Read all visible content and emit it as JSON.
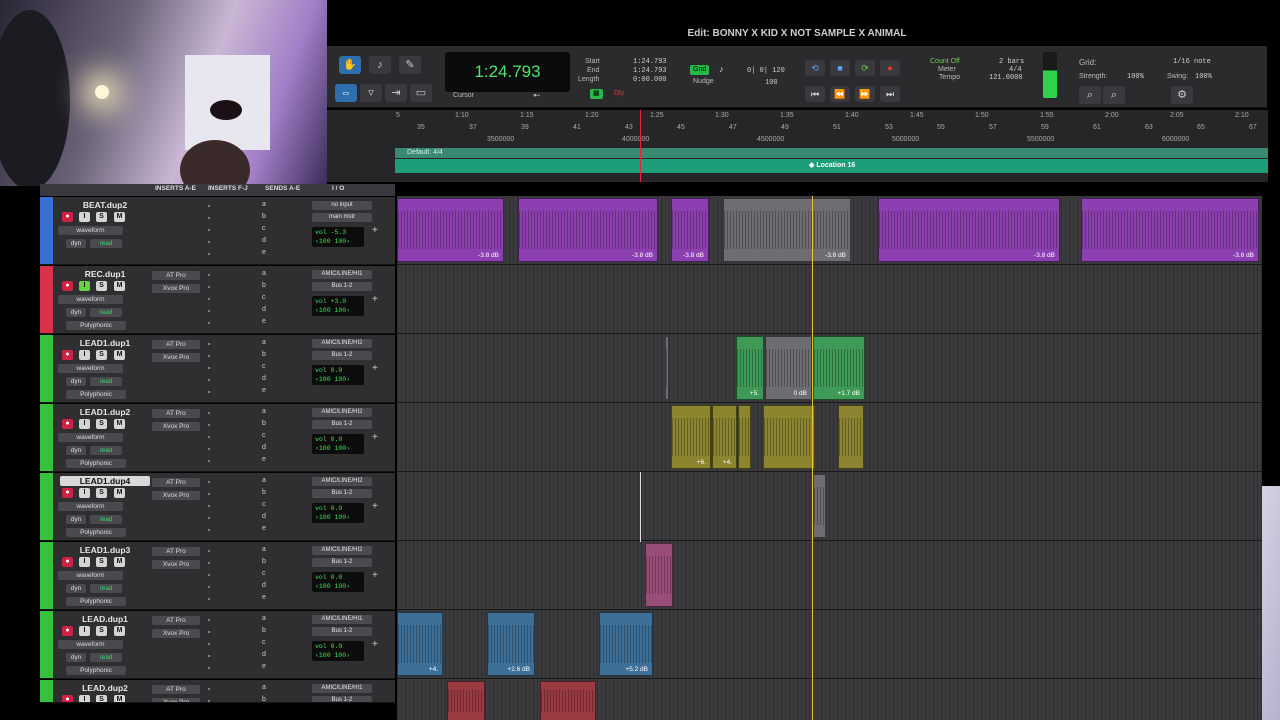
{
  "window": {
    "title": "Edit: BONNY X KID X NOT SAMPLE X ANIMAL"
  },
  "toolbar": {
    "counter": "1:24.793",
    "start_label": "Start",
    "end_label": "End",
    "length_label": "Length",
    "start_val": "1:24.793",
    "end_val": "1:24.793",
    "length_val": "0:00.000",
    "grid_label": "Grid",
    "grid_val": "0| 0| 120",
    "nudge_label": "Nudge",
    "nudge_val": "100",
    "cursor_label": "Cursor",
    "dly_label": "Dly",
    "count_off_label": "Count Off",
    "count_off_val": "2 bars",
    "meter_label": "Meter",
    "meter_val": "4/4",
    "tempo_label": "Tempo",
    "tempo_val": "121.0000",
    "grid2_label": "Grid:",
    "grid2_val": "1/16 note",
    "strength_label": "Strength:",
    "strength_val": "100%",
    "swing_label": "Swing:",
    "swing_val": "100%"
  },
  "ruler": {
    "time_ticks": [
      "1:10",
      "1:15",
      "1:20",
      "1:25",
      "1:30",
      "1:35",
      "1:40",
      "1:45",
      "1:50",
      "1:55",
      "2:00",
      "2:05",
      "2:10"
    ],
    "bar_ticks": [
      "35",
      "37",
      "39",
      "41",
      "43",
      "45",
      "47",
      "49",
      "51",
      "53",
      "55",
      "57",
      "59",
      "61",
      "63",
      "65",
      "67"
    ],
    "sample_ticks": [
      "3500000",
      "4000000",
      "4500000",
      "5000000",
      "5500000",
      "6000000"
    ],
    "meter_marker": "Default: 4/4",
    "location_marker": "Location 16",
    "left_tick": "5"
  },
  "columns": {
    "inserts_ae": "INSERTS A-E",
    "inserts_fj": "INSERTS F-J",
    "sends_ae": "SENDS A-E",
    "io": "I / O"
  },
  "tracks": [
    {
      "name": "BEAT.dup2",
      "color": "#3a6fd6",
      "view": "waveform",
      "dyn": "dyn",
      "mode": "read",
      "ins1": "",
      "ins2": "",
      "in": "no input",
      "out": "main mstr",
      "vol": "-5.3",
      "pan": "100",
      "pan2": "100",
      "extra": ""
    },
    {
      "name": "REC.dup1",
      "color": "#d9314a",
      "view": "waveform",
      "dyn": "dyn",
      "mode": "read",
      "ins1": "AT Pro",
      "ins2": "Xvox Pro",
      "in": "AMIC/LINE/HI1",
      "out": "Bus 1-2",
      "vol": "+3.0",
      "pan": "100",
      "pan2": "100",
      "extra": "Polyphonic"
    },
    {
      "name": "LEAD1.dup1",
      "color": "#36c13f",
      "view": "waveform",
      "dyn": "dyn",
      "mode": "read",
      "ins1": "AT Pro",
      "ins2": "Xvox Pro",
      "in": "AMIC/LINE/HI2",
      "out": "Bus 1-2",
      "vol": "0.0",
      "pan": "100",
      "pan2": "100",
      "extra": "Polyphonic"
    },
    {
      "name": "LEAD1.dup2",
      "color": "#36c13f",
      "view": "waveform",
      "dyn": "dyn",
      "mode": "read",
      "ins1": "AT Pro",
      "ins2": "Xvox Pro",
      "in": "AMIC/LINE/HI2",
      "out": "Bus 1-2",
      "vol": "0.0",
      "pan": "100",
      "pan2": "100",
      "extra": "Polyphonic"
    },
    {
      "name": "LEAD1.dup4",
      "color": "#36c13f",
      "view": "waveform",
      "dyn": "dyn",
      "mode": "read",
      "ins1": "AT Pro",
      "ins2": "Xvox Pro",
      "in": "AMIC/LINE/HI2",
      "out": "Bus 1-2",
      "vol": "0.0",
      "pan": "100",
      "pan2": "100",
      "extra": "Polyphonic"
    },
    {
      "name": "LEAD1.dup3",
      "color": "#36c13f",
      "view": "waveform",
      "dyn": "dyn",
      "mode": "read",
      "ins1": "AT Pro",
      "ins2": "Xvox Pro",
      "in": "AMIC/LINE/HI2",
      "out": "Bus 1-2",
      "vol": "0.0",
      "pan": "100",
      "pan2": "100",
      "extra": "Polyphonic"
    },
    {
      "name": "LEAD.dup1",
      "color": "#36c13f",
      "view": "waveform",
      "dyn": "dyn",
      "mode": "read",
      "ins1": "AT Pro",
      "ins2": "Xvox Pro",
      "in": "AMIC/LINE/HI1",
      "out": "Bus 1-2",
      "vol": "0.0",
      "pan": "100",
      "pan2": "100",
      "extra": "Polyphonic"
    },
    {
      "name": "LEAD.dup2",
      "color": "#36c13f",
      "view": "waveform",
      "dyn": "dyn",
      "mode": "read",
      "ins1": "AT Pro",
      "ins2": "Xvox Pro",
      "in": "AMIC/LINE/HI1",
      "out": "Bus 1-2",
      "vol": "",
      "pan": "",
      "pan2": "",
      "extra": ""
    }
  ],
  "clips": {
    "beat": [
      "-3.8 dB",
      "-3.8 dB",
      "-3.8 dB",
      "-3.8 dB",
      "-3.8 dB",
      "-3.8 dB"
    ],
    "lead1_dup1": [
      "+5.",
      "0 dB",
      "+1.7 dB"
    ],
    "lead1_dup2": [
      "+6.",
      "+4."
    ],
    "lead_dup1": [
      "+4.",
      "+2.6 dB",
      "+5.2 dB"
    ]
  },
  "colors": {
    "beat_clip": "#8c3fb0",
    "gray_clip": "#6e6e72",
    "green_clip": "#3f9a58",
    "yellow_clip": "#8c8530",
    "blue_clip": "#3e6f96",
    "red_clip": "#9a3a42",
    "pink_clip": "#9b4d7a"
  }
}
